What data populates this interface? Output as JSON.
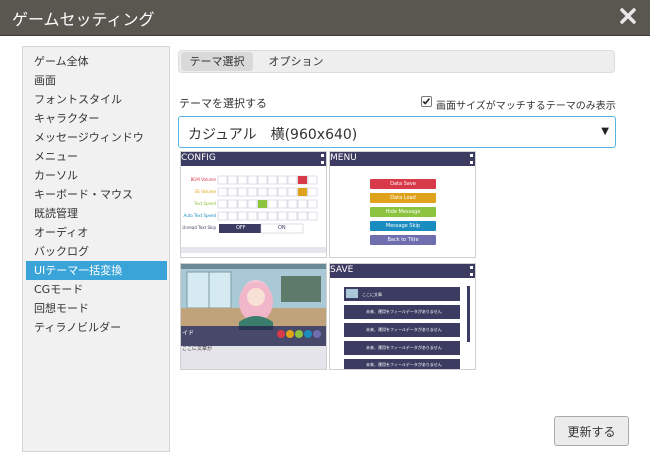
{
  "window": {
    "title": "ゲームセッティング"
  },
  "sidebar": {
    "items": [
      {
        "label": "ゲーム全体"
      },
      {
        "label": "画面"
      },
      {
        "label": "フォントスタイル"
      },
      {
        "label": "キャラクター"
      },
      {
        "label": "メッセージウィンドウ"
      },
      {
        "label": "メニュー"
      },
      {
        "label": "カーソル"
      },
      {
        "label": "キーボード・マウス"
      },
      {
        "label": "既読管理"
      },
      {
        "label": "オーディオ"
      },
      {
        "label": "バックログ"
      },
      {
        "label": "UIテーマ一括変換",
        "active": true
      },
      {
        "label": "CGモード"
      },
      {
        "label": "回想モード"
      },
      {
        "label": "ティラノビルダー"
      }
    ]
  },
  "tabs": [
    {
      "label": "テーマ選択",
      "active": true
    },
    {
      "label": "オプション"
    }
  ],
  "theme": {
    "select_label": "テーマを選択する",
    "filter_checked": true,
    "filter_label": "画面サイズがマッチするテーマのみ表示",
    "selected": "カジュアル　横(960x640)"
  },
  "thumbs": {
    "config": {
      "header": "CONFIG",
      "rows": [
        "BGM Volume",
        "SE Volume",
        "Text Speed",
        "Auto Text Speed",
        "Unread Text Skip"
      ],
      "off": "OFF",
      "on": "ON"
    },
    "menu": {
      "header": "MENU",
      "buttons": [
        {
          "label": "Data Save",
          "color": "#d83a4a"
        },
        {
          "label": "Data Load",
          "color": "#e0a21a"
        },
        {
          "label": "Hide Message",
          "color": "#8cc43f"
        },
        {
          "label": "Message Skip",
          "color": "#1a8cc0"
        },
        {
          "label": "Back to Title",
          "color": "#6f6fb0"
        }
      ]
    },
    "game": {
      "side_text": "イド",
      "msg_text": "ここに文章が"
    },
    "save": {
      "header": "SAVE",
      "first_slot": "ここに文章",
      "slot_text": "未来、運用をフィールデータがありません",
      "slot_count": 5
    }
  },
  "actions": {
    "refresh": "更新する"
  },
  "colors": {
    "accent": "#3aa4d8",
    "titlebar": "#5a5650",
    "thumb_header": "#3c3c62"
  }
}
